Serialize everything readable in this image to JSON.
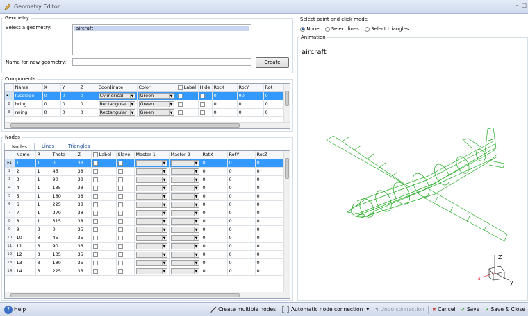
{
  "window": {
    "title": "Geometry Editor"
  },
  "geometry": {
    "section_label": "Geometry",
    "select_label": "Select a geometry:",
    "list_items": [
      "aircraft"
    ],
    "name_label": "Name for new geometry:",
    "name_value": "",
    "create_label": "Create"
  },
  "components": {
    "section_label": "Components",
    "columns": [
      "Name",
      "X",
      "Y",
      "Z",
      "Coordinate",
      "Color",
      "Label",
      "Hide",
      "RotX",
      "RotY",
      "Rot"
    ],
    "rows": [
      {
        "num": "1",
        "name": "fuselage",
        "x": "0",
        "y": "0",
        "z": "0",
        "coord": "Cylindrical",
        "color": "Green",
        "rotx": "0",
        "roty": "90",
        "rot": "0"
      },
      {
        "num": "2",
        "name": "lwing",
        "x": "0",
        "y": "0",
        "z": "0",
        "coord": "Rectangular",
        "color": "Green",
        "rotx": "0",
        "roty": "0",
        "rot": "0"
      },
      {
        "num": "3",
        "name": "rwing",
        "x": "0",
        "y": "0",
        "z": "0",
        "coord": "Rectangular",
        "color": "Green",
        "rotx": "0",
        "roty": "0",
        "rot": "0"
      }
    ]
  },
  "nodes": {
    "section_label": "Nodes",
    "tabs": [
      "Nodes",
      "Lines",
      "Triangles"
    ],
    "columns": [
      "Name",
      "R",
      "Theta",
      "Z",
      "Label",
      "Slave",
      "Master 1",
      "Master 2",
      "RotX",
      "RotY",
      "RotZ"
    ],
    "rows": [
      {
        "num": "1",
        "name": "1",
        "r": "1",
        "theta": "0",
        "z": "38",
        "rotx": "0",
        "roty": "0",
        "rotz": "0"
      },
      {
        "num": "2",
        "name": "2",
        "r": "1",
        "theta": "45",
        "z": "38",
        "rotx": "0",
        "roty": "0",
        "rotz": "0"
      },
      {
        "num": "3",
        "name": "3",
        "r": "1",
        "theta": "90",
        "z": "38",
        "rotx": "0",
        "roty": "0",
        "rotz": "0"
      },
      {
        "num": "4",
        "name": "4",
        "r": "1",
        "theta": "135",
        "z": "38",
        "rotx": "0",
        "roty": "0",
        "rotz": "0"
      },
      {
        "num": "5",
        "name": "5",
        "r": "1",
        "theta": "180",
        "z": "38",
        "rotx": "0",
        "roty": "0",
        "rotz": "0"
      },
      {
        "num": "6",
        "name": "6",
        "r": "1",
        "theta": "225",
        "z": "38",
        "rotx": "0",
        "roty": "0",
        "rotz": "0"
      },
      {
        "num": "7",
        "name": "7",
        "r": "1",
        "theta": "270",
        "z": "38",
        "rotx": "0",
        "roty": "0",
        "rotz": "0"
      },
      {
        "num": "8",
        "name": "8",
        "r": "1",
        "theta": "315",
        "z": "38",
        "rotx": "0",
        "roty": "0",
        "rotz": "0"
      },
      {
        "num": "9",
        "name": "9",
        "r": "3",
        "theta": "0",
        "z": "35",
        "rotx": "0",
        "roty": "0",
        "rotz": "0"
      },
      {
        "num": "10",
        "name": "10",
        "r": "3",
        "theta": "45",
        "z": "35",
        "rotx": "0",
        "roty": "0",
        "rotz": "0"
      },
      {
        "num": "11",
        "name": "11",
        "r": "3",
        "theta": "90",
        "z": "35",
        "rotx": "0",
        "roty": "0",
        "rotz": "0"
      },
      {
        "num": "12",
        "name": "12",
        "r": "3",
        "theta": "135",
        "z": "35",
        "rotx": "0",
        "roty": "0",
        "rotz": "0"
      },
      {
        "num": "13",
        "name": "13",
        "r": "3",
        "theta": "180",
        "z": "35",
        "rotx": "0",
        "roty": "0",
        "rotz": "0"
      },
      {
        "num": "14",
        "name": "14",
        "r": "3",
        "theta": "225",
        "z": "35",
        "rotx": "0",
        "roty": "0",
        "rotz": "0"
      }
    ]
  },
  "mode": {
    "section_label": "Select point and click mode",
    "options": [
      "None",
      "Select lines",
      "Select triangles"
    ],
    "selected": "None"
  },
  "animation": {
    "section_label": "Animation",
    "model_name": "aircraft",
    "axis_z": "Z",
    "axis_y": "y",
    "axis_x": "x"
  },
  "statusbar": {
    "help": "Help",
    "create_multiple": "Create multiple nodes",
    "auto_connect": "Automatic node connection",
    "undo": "Undo connection",
    "cancel": "Cancel",
    "save": "Save",
    "save_close": "Save & Close"
  },
  "colors": {
    "selection": "#3399ff",
    "wireframe": "#22aa22",
    "accent": "#1a4fa0"
  }
}
